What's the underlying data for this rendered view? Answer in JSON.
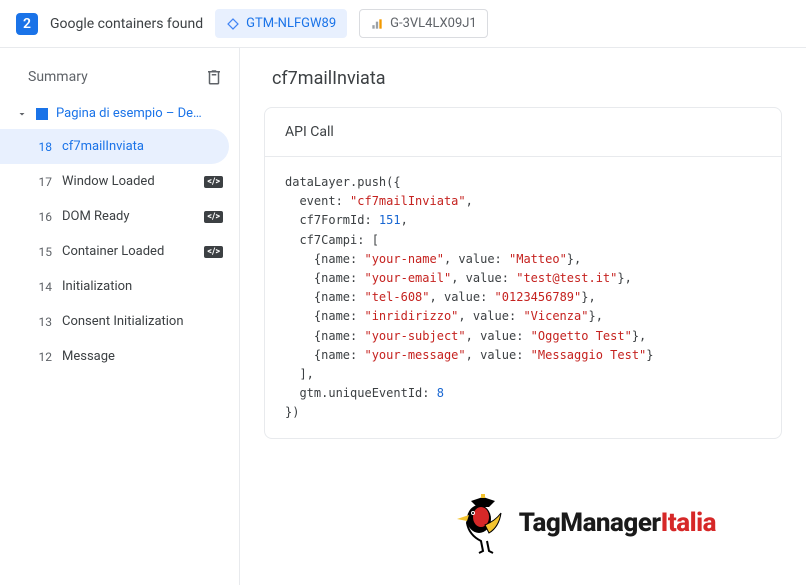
{
  "topbar": {
    "count": "2",
    "label": "Google containers found",
    "gtm_id": "GTM-NLFGW89",
    "ga_id": "G-3VL4LX09J1"
  },
  "sidebar": {
    "summary_label": "Summary",
    "page_title": "Pagina di esempio – De…",
    "events": [
      {
        "num": "18",
        "name": "cf7mailInviata",
        "selected": true,
        "badge": false
      },
      {
        "num": "17",
        "name": "Window Loaded",
        "selected": false,
        "badge": true
      },
      {
        "num": "16",
        "name": "DOM Ready",
        "selected": false,
        "badge": true
      },
      {
        "num": "15",
        "name": "Container Loaded",
        "selected": false,
        "badge": true
      },
      {
        "num": "14",
        "name": "Initialization",
        "selected": false,
        "badge": false
      },
      {
        "num": "13",
        "name": "Consent Initialization",
        "selected": false,
        "badge": false
      },
      {
        "num": "12",
        "name": "Message",
        "selected": false,
        "badge": false
      }
    ]
  },
  "content": {
    "heading": "cf7mailInviata",
    "panel_title": "API Call",
    "code": {
      "pre1": "dataLayer.push({\n  event: ",
      "event_val": "\"cf7mailInviata\"",
      "pre2": ",\n  cf7FormId: ",
      "formid_val": "151",
      "pre3": ",\n  cf7Campi: [\n    {name: ",
      "f1n": "\"your-name\"",
      "f1v": "\"Matteo\"",
      "f2n": "\"your-email\"",
      "f2v": "\"test@test.it\"",
      "f3n": "\"tel-608\"",
      "f3v": "\"0123456789\"",
      "f4n": "\"inridirizzo\"",
      "f4v": "\"Vicenza\"",
      "f5n": "\"your-subject\"",
      "f5v": "\"Oggetto Test\"",
      "f6n": "\"your-message\"",
      "f6v": "\"Messaggio Test\"",
      "sep_nv": ", value: ",
      "row_end_comma": "},\n    {name: ",
      "row_end_last": "}\n  ],\n  gtm.uniqueEventId: ",
      "uid_val": "8",
      "tail": "\n})"
    }
  },
  "logo": {
    "text1": "TagManager",
    "text2": "Italia"
  }
}
